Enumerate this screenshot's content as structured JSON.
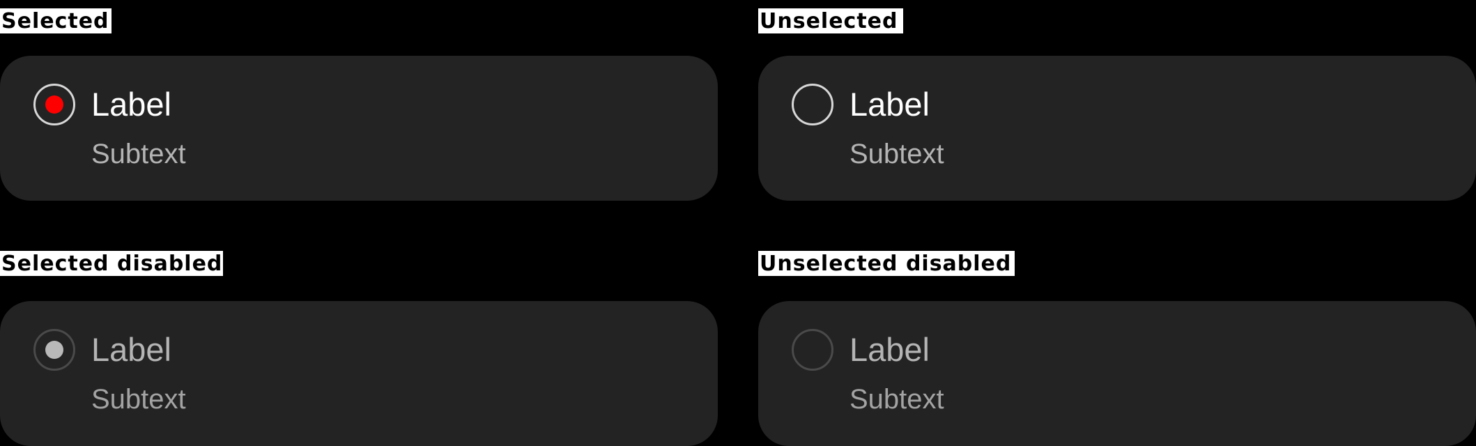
{
  "sections": [
    {
      "title": "Selected",
      "state": "selected",
      "enabled": true,
      "label": "Label",
      "subtext": "Subtext"
    },
    {
      "title": "Unselected",
      "state": "unselected",
      "enabled": true,
      "label": "Label",
      "subtext": "Subtext"
    },
    {
      "title": "Selected disabled",
      "state": "selected",
      "enabled": false,
      "label": "Label",
      "subtext": "Subtext"
    },
    {
      "title": "Unselected disabled",
      "state": "unselected",
      "enabled": false,
      "label": "Label",
      "subtext": "Subtext"
    }
  ],
  "colors": {
    "background": "#000000",
    "card": "#232323",
    "accent": "#ff0000",
    "label": "#ffffff",
    "subtext": "#b4b4b4",
    "disabled_dot": "#b9b9b9",
    "disabled_ring": "#4a4a4a"
  }
}
